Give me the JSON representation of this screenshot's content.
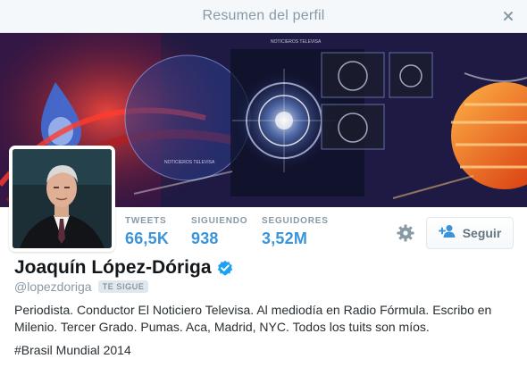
{
  "modal": {
    "title": "Resumen del perfil",
    "close_icon": "close-icon"
  },
  "banner": {
    "captions": [
      "NOTICIEROS TELEVISA",
      "NOTICIEROS TELEVISA"
    ]
  },
  "profile": {
    "name": "Joaquín López-Dóriga",
    "handle": "@lopezdoriga",
    "follows_you_badge": "TE SIGUE",
    "verified": true,
    "bio": "Periodista. Conductor El Noticiero Televisa. Al mediodía en Radio Fórmula. Escribo en Milenio. Tercer Grado. Pumas. Aca, Madrid, NYC. Todos los tuits son míos.",
    "hashtag_line": "#Brasil Mundial 2014"
  },
  "stats": [
    {
      "label": "TWEETS",
      "value": "66,5K"
    },
    {
      "label": "SIGUIENDO",
      "value": "938"
    },
    {
      "label": "SEGUIDORES",
      "value": "3,52M"
    }
  ],
  "actions": {
    "follow_label": "Seguir",
    "gear_icon": "gear-icon",
    "follow_icon": "add-user-icon"
  },
  "colors": {
    "accent": "#3b94d9",
    "verified": "#1da1f2",
    "muted": "#8899a6"
  }
}
